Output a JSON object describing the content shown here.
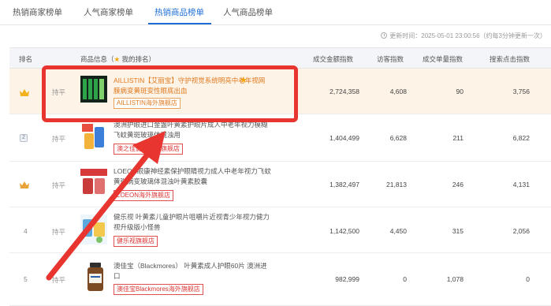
{
  "tabs": [
    {
      "label": "热销商家榜单"
    },
    {
      "label": "人气商家榜单"
    },
    {
      "label": "热销商品榜单"
    },
    {
      "label": "人气商品榜单"
    }
  ],
  "active_tab": 2,
  "update": {
    "label": "更新时间：2025-05-01 23:00:56（约每3分钟更新一次）"
  },
  "table": {
    "headers": {
      "rank": "排名",
      "product": "商品信息（",
      "product_star": "★",
      "product_suffix": " 我的排名）",
      "gmv": "成交金额指数",
      "visitors": "访客指数",
      "orders": "成交单量指数",
      "search": "搜索点击指数"
    },
    "rows": [
      {
        "rank": "",
        "trend": "持平",
        "title": "AILLISTIN【艾丽宝】守护视觉系统明亮中老年视网膜病变黄斑变性眼底出血",
        "shop": "AILLISTIN海外旗舰店",
        "gmv": "2,724,358",
        "visitors": "4,608",
        "orders": "90",
        "search": "3,756"
      },
      {
        "rank": "2",
        "trend": "持平",
        "title": "澳洲护眼进口金盏叶黄素护眼片成人中老年视力模糊飞蚊黄斑玻璃体混浊用",
        "shop": "澳之佳健康食品旗舰店",
        "gmv": "1,404,499",
        "visitors": "6,628",
        "orders": "211",
        "search": "6,822"
      },
      {
        "rank": "",
        "trend": "持平",
        "title": "LOEON眼康神经素保护眼睛视力成人中老年视力飞蚊黄斑病变玻璃体混浊叶黄素胶囊",
        "shop": "LOEON海外旗舰店",
        "gmv": "1,382,497",
        "visitors": "21,813",
        "orders": "246",
        "search": "4,131"
      },
      {
        "rank": "4",
        "trend": "持平",
        "title": "健乐视 叶黄素儿童护眼片咀嚼片近视青少年视力健力视升级版小怪兽",
        "shop": "健乐视旗舰店",
        "gmv": "1,142,500",
        "visitors": "4,450",
        "orders": "315",
        "search": "2,056"
      },
      {
        "rank": "5",
        "trend": "持平",
        "title": "澳佳宝（Blackmores） 叶黄素成人护眼60片 澳洲进口",
        "shop": "澳佳宝Blackmores海外旗舰店",
        "gmv": "982,999",
        "visitors": "0",
        "orders": "1,078",
        "search": "0"
      }
    ]
  },
  "colors": {
    "accent": "#1f6fd6",
    "highlight": "#e83530",
    "row1_bg": "#fdf3e7",
    "shop_border": "#e05050",
    "gold": "#f2a500"
  },
  "icons": {
    "clock": "clock-icon",
    "crown": "crown-icon",
    "rank2": "rank-badge-icon",
    "star": "star-icon"
  }
}
